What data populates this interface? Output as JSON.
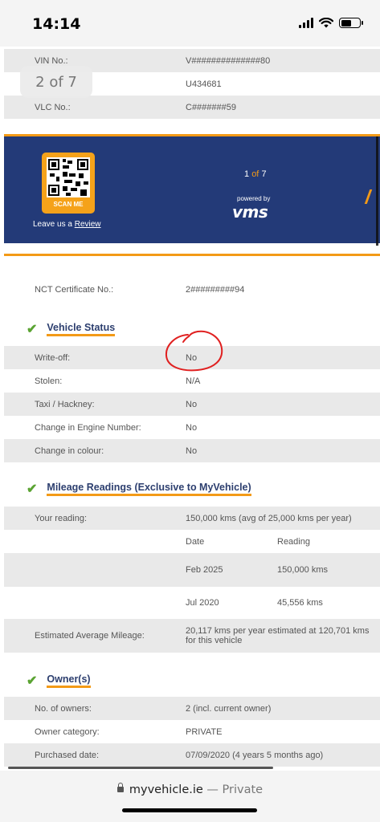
{
  "status": {
    "time": "14:14"
  },
  "page_indicator": "2 of 7",
  "top_rows": [
    {
      "label": "VIN No.:",
      "value": "V##############80"
    },
    {
      "label": "",
      "value": "U434681"
    },
    {
      "label": "VLC No.:",
      "value": "C#######59"
    }
  ],
  "banner": {
    "scan_me": "SCAN ME",
    "review_prefix": "Leave us a ",
    "review_link": "Review",
    "page_current": "1",
    "page_of": "of",
    "page_total": "7",
    "powered_by": "powered by",
    "brand": "vms"
  },
  "nct": {
    "label": "NCT Certificate No.:",
    "value": "2#########94"
  },
  "vehicle_status": {
    "title": "Vehicle Status",
    "rows": [
      {
        "label": "Write-off:",
        "value": "No"
      },
      {
        "label": "Stolen:",
        "value": "N/A"
      },
      {
        "label": "Taxi / Hackney:",
        "value": "No"
      },
      {
        "label": "Change in Engine Number:",
        "value": "No"
      },
      {
        "label": "Change in colour:",
        "value": "No"
      }
    ]
  },
  "mileage": {
    "title": "Mileage Readings (Exclusive to MyVehicle)",
    "your_reading_label": "Your reading:",
    "your_reading_value": "150,000 kms (avg of 25,000 kms per year)",
    "col_date": "Date",
    "col_reading": "Reading",
    "entries": [
      {
        "date": "Feb 2025",
        "reading": "150,000 kms"
      },
      {
        "date": "Jul 2020",
        "reading": "45,556 kms"
      }
    ],
    "estimate_label": "Estimated Average Mileage:",
    "estimate_value": "20,117 kms per year estimated at 120,701 kms for this vehicle"
  },
  "owners": {
    "title": "Owner(s)",
    "rows": [
      {
        "label": "No. of owners:",
        "value": "2 (incl. current owner)"
      },
      {
        "label": "Owner category:",
        "value": "PRIVATE"
      },
      {
        "label": "Purchased date:",
        "value": "07/09/2020 (4 years 5 months ago)"
      }
    ]
  },
  "browser": {
    "domain": "myvehicle.ie",
    "mode": " — Private"
  },
  "colors": {
    "navy": "#233a78",
    "orange": "#f39a17",
    "check_green": "#5aa332",
    "annotation_red": "#e02020"
  }
}
